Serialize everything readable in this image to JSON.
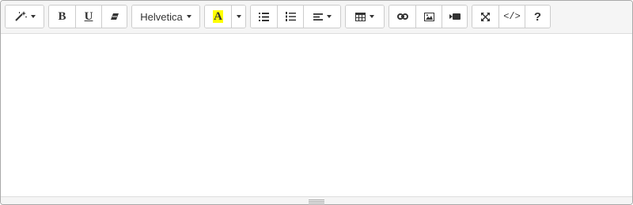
{
  "toolbar": {
    "style_icon": "magic-wand-icon",
    "bold_label": "B",
    "underline_label": "U",
    "clear_icon": "eraser-icon",
    "font_name": "Helvetica",
    "highlight_label": "A",
    "highlight_color": "#ffff00",
    "unordered_list_icon": "unordered-list-icon",
    "ordered_list_icon": "ordered-list-icon",
    "paragraph_icon": "align-left-icon",
    "table_icon": "table-icon",
    "link_icon": "link-icon",
    "picture_icon": "picture-icon",
    "video_icon": "video-icon",
    "fullscreen_icon": "fullscreen-icon",
    "codeview_label": "</>",
    "help_label": "?"
  },
  "colors": {
    "border": "#a9a9a9",
    "toolbar_bg": "#f5f5f5",
    "button_border": "#cccccc",
    "icon": "#333333"
  }
}
